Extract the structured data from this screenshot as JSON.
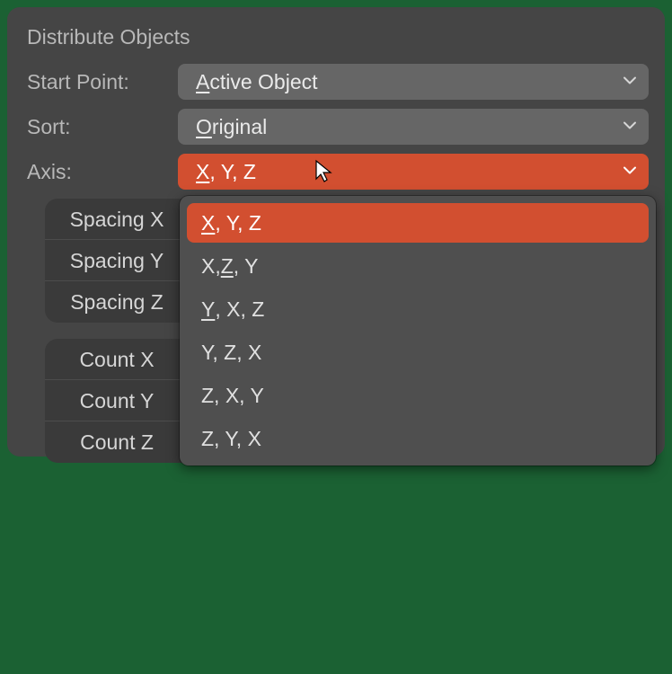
{
  "panel": {
    "title": "Distribute Objects",
    "start_point_label": "Start Point:",
    "start_point_value_pre": "",
    "start_point_value_u": "A",
    "start_point_value_post": "ctive Object",
    "sort_label": "Sort:",
    "sort_value_u": "O",
    "sort_value_post": "riginal",
    "axis_label": "Axis:",
    "axis_value_u": "X",
    "axis_value_post": ", Y, Z",
    "props_a": [
      "Spacing X",
      "Spacing Y",
      "Spacing Z"
    ],
    "props_b": [
      "Count X",
      "Count Y",
      "Count Z"
    ]
  },
  "dropdown": {
    "items": [
      {
        "pre": "",
        "u": "X",
        "post": ", Y, Z",
        "selected": true
      },
      {
        "pre": "X, ",
        "u": "Z",
        "post": ", Y",
        "selected": false
      },
      {
        "pre": "",
        "u": "Y",
        "post": ", X, Z",
        "selected": false
      },
      {
        "pre": "Y, Z, X",
        "u": "",
        "post": "",
        "selected": false
      },
      {
        "pre": "Z, X, Y",
        "u": "",
        "post": "",
        "selected": false
      },
      {
        "pre": "Z, Y, X",
        "u": "",
        "post": "",
        "selected": false
      }
    ]
  }
}
